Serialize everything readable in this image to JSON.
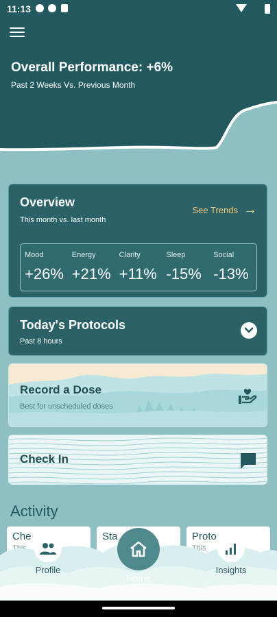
{
  "status_bar": {
    "time": "11:13"
  },
  "header": {
    "title": "Overall Performance: +6%",
    "subtitle": "Past 2 Weeks Vs. Previous Month"
  },
  "overview": {
    "title": "Overview",
    "subtitle": "This month vs. last month",
    "see_trends": "See Trends",
    "metrics": [
      {
        "label": "Mood",
        "value": "+26%"
      },
      {
        "label": "Energy",
        "value": "+21%"
      },
      {
        "label": "Clarity",
        "value": "+11%"
      },
      {
        "label": "Sleep",
        "value": "-15%"
      },
      {
        "label": "Social",
        "value": "-13%"
      }
    ]
  },
  "protocols": {
    "title": "Today's Protocols",
    "subtitle": "Past 8 hours"
  },
  "record_dose": {
    "title": "Record a Dose",
    "subtitle": "Best for unscheduled doses"
  },
  "check_in": {
    "title": "Check In"
  },
  "activity": {
    "title": "Activity",
    "cards": [
      {
        "title": "Che",
        "subtitle": "This"
      },
      {
        "title": "Sta",
        "subtitle": ""
      },
      {
        "title": "Proto",
        "subtitle": "This"
      }
    ]
  },
  "nav": {
    "profile": "Profile",
    "home": "Home",
    "insights": "Insights"
  },
  "colors": {
    "header_bg": "#21595e",
    "card_bg": "#2a6267",
    "accent_yellow": "#f5c977",
    "page_bg": "#8ebfc2",
    "nav_circle": "#4e8a8d"
  }
}
